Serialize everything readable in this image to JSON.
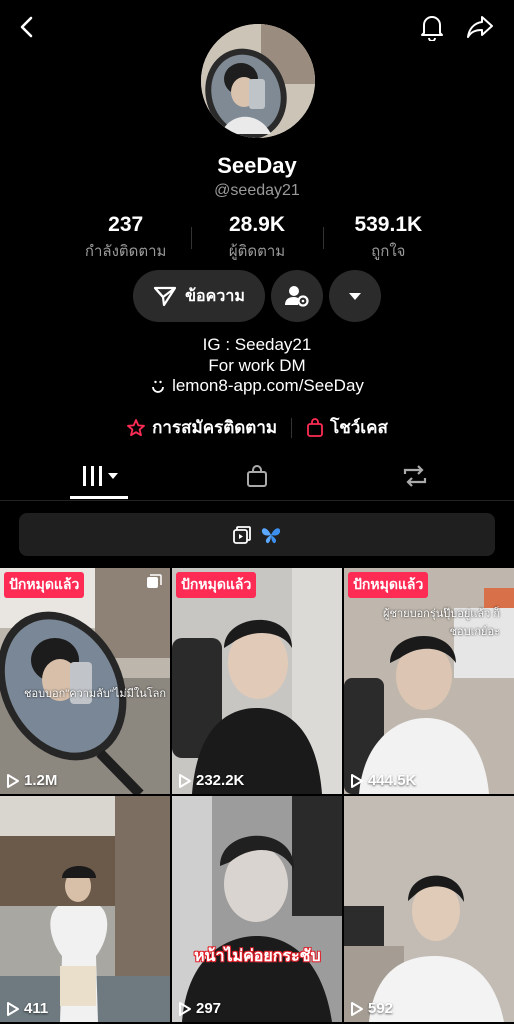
{
  "profile": {
    "name": "SeeDay",
    "handle": "@seeday21",
    "stats": [
      {
        "value": "237",
        "label": "กำลังติดตาม"
      },
      {
        "value": "28.9K",
        "label": "ผู้ติดตาม"
      },
      {
        "value": "539.1K",
        "label": "ถูกใจ"
      }
    ],
    "message_label": "ข้อความ",
    "bio_line1": "IG : Seeday21",
    "bio_line2": "For work DM",
    "link": "lemon8-app.com/SeeDay",
    "subscribe_label": "การสมัครติดตาม",
    "showcase_label": "โชว์เคส"
  },
  "colors": {
    "accent": "#fe2c55",
    "button_bg": "#2b2b2b"
  },
  "videos": [
    {
      "badge": "ปักหมุดแล้ว",
      "views": "1.2M",
      "caption": "ชอบบอก\"ความลับ\"ไม่มีในโลก"
    },
    {
      "badge": "ปักหมุดแล้ว",
      "views": "232.2K",
      "caption": ""
    },
    {
      "badge": "ปักหมุดแล้ว",
      "views": "444.5K",
      "caption": "ผู้ชายบอกรุ่นปุ๊บอยู่แล้ว ก็ชอบเกย์อะ"
    },
    {
      "badge": "",
      "views": "411",
      "caption": ""
    },
    {
      "badge": "",
      "views": "297",
      "caption": "หน้าไม่ค่อยกระชับ"
    },
    {
      "badge": "",
      "views": "592",
      "caption": ""
    }
  ]
}
